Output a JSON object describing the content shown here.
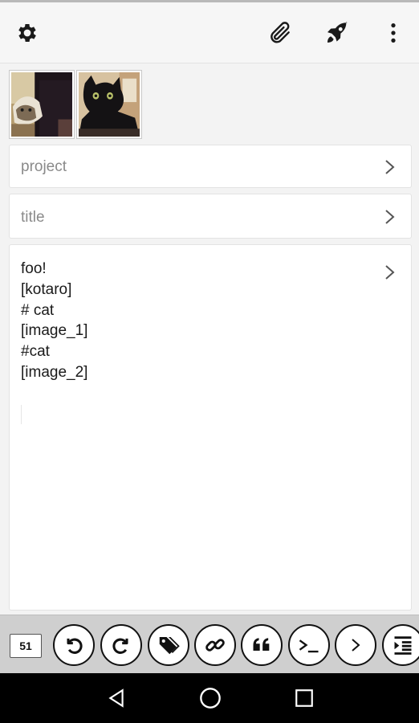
{
  "icons": {
    "settings": "gear-icon",
    "attach": "paperclip-icon",
    "post": "rocket-icon",
    "overflow": "more-vert-icon"
  },
  "images": [
    {
      "name": "thumbnail-image-1",
      "subject": "cat photo"
    },
    {
      "name": "thumbnail-image-2",
      "subject": "black cat photo"
    }
  ],
  "fields": {
    "project_placeholder": "project",
    "title_placeholder": "title"
  },
  "body_lines": [
    "foo!",
    "[kotaro]",
    "# cat",
    "[image_1]",
    "#cat",
    "[image_2]"
  ],
  "keybar": {
    "char_count": "51",
    "buttons": [
      "undo-icon",
      "redo-icon",
      "tag-icon",
      "link-icon",
      "quote-icon",
      "terminal-icon",
      "chevron-right-icon",
      "indent-icon"
    ]
  },
  "nav": [
    "back-icon",
    "home-icon",
    "recents-icon"
  ]
}
